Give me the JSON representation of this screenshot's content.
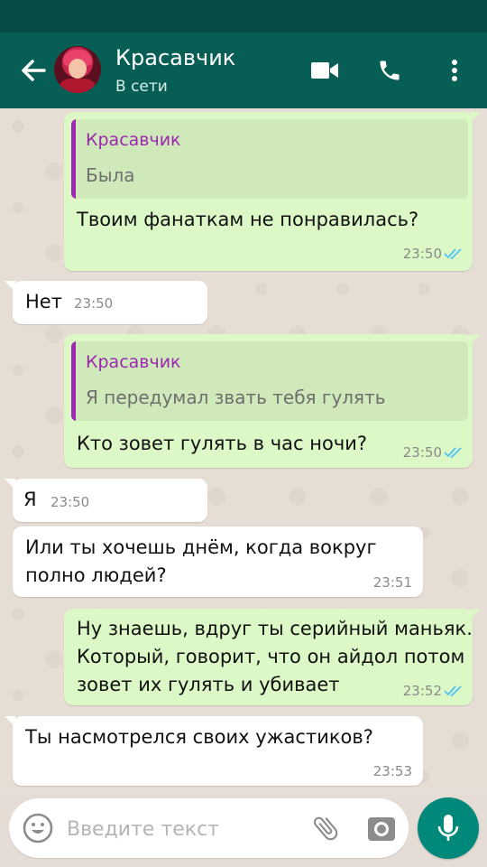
{
  "header": {
    "contact_name": "Красавчик",
    "contact_status": "В сети"
  },
  "messages": [
    {
      "direction": "outgoing",
      "quote": {
        "author": "Красавчик",
        "text": "Была"
      },
      "text": "Твоим фанаткам не понравилась?",
      "time": "23:50",
      "ticks": "read"
    },
    {
      "direction": "incoming",
      "text": "Нет",
      "time": "23:50"
    },
    {
      "direction": "outgoing",
      "quote": {
        "author": "Красавчик",
        "text": "Я передумал звать тебя гулять"
      },
      "text": "Кто зовет гулять в час ночи?",
      "time": "23:50",
      "ticks": "read"
    },
    {
      "direction": "incoming",
      "text": "Я",
      "time": "23:50"
    },
    {
      "direction": "incoming",
      "text": "Или ты хочешь днём, когда вокруг\nполно людей?",
      "time": "23:51"
    },
    {
      "direction": "outgoing",
      "text": "Ну знаешь, вдруг ты серийный маньяк.\nКоторый, говорит, что он айдол потом\nзовет их гулять и убивает",
      "time": "23:52",
      "ticks": "read"
    },
    {
      "direction": "incoming",
      "text": "Ты насмотрелся своих ужастиков?",
      "time": "23:53"
    }
  ],
  "composer": {
    "placeholder": "Введите текст"
  },
  "colors": {
    "header": "#075e54",
    "statusbar": "#054d44",
    "outgoing_bubble": "#dcf8c6",
    "incoming_bubble": "#ffffff",
    "quote_accent": "#9c27b0",
    "read_ticks": "#4fc3f7",
    "mic_button": "#00897b"
  },
  "icons": {
    "back": "arrow-left-icon",
    "video": "video-camera-icon",
    "call": "phone-icon",
    "menu": "more-vertical-icon",
    "emoji": "emoji-icon",
    "attach": "paperclip-icon",
    "camera": "camera-icon",
    "mic": "microphone-icon",
    "ticks": "double-check-icon"
  }
}
